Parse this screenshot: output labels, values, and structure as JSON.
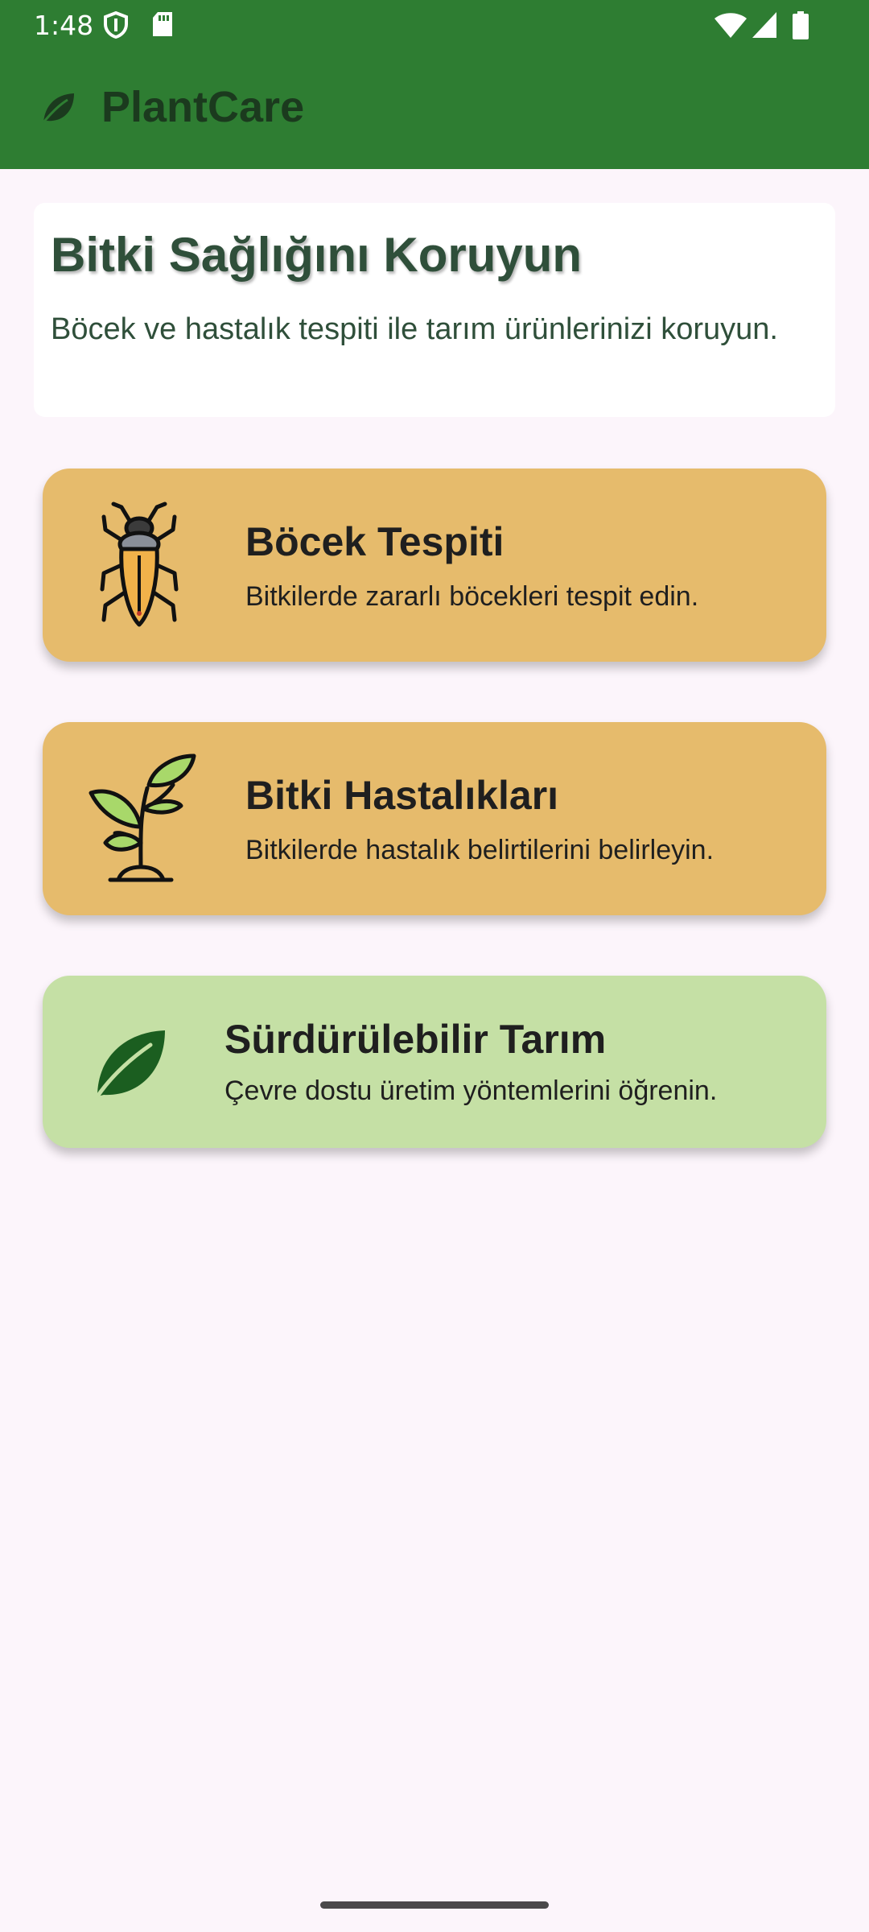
{
  "status_bar": {
    "time": "1:48",
    "icons": [
      "shield-icon",
      "sd-card-icon",
      "wifi-icon",
      "signal-icon",
      "battery-icon"
    ]
  },
  "app_bar": {
    "title": "PlantCare",
    "logo_icon": "leaf-icon",
    "background": "#2e7d32"
  },
  "intro": {
    "title": "Bitki Sağlığını Koruyun",
    "description": "Böcek ve hastalık tespiti ile tarım ürünlerinizi koruyun."
  },
  "features": [
    {
      "title": "Böcek Tespiti",
      "description": "Bitkilerde zararlı böcekleri tespit edin.",
      "icon": "insect-icon",
      "color": "#e6bb6c"
    },
    {
      "title": "Bitki Hastalıkları",
      "description": "Bitkilerde hastalık belirtilerini belirleyin.",
      "icon": "sprout-icon",
      "color": "#e6bb6c"
    },
    {
      "title": "Sürdürülebilir Tarım",
      "description": "Çevre dostu üretim yöntemlerini öğrenin.",
      "icon": "leaf-icon",
      "color": "#c5e0a5"
    }
  ]
}
